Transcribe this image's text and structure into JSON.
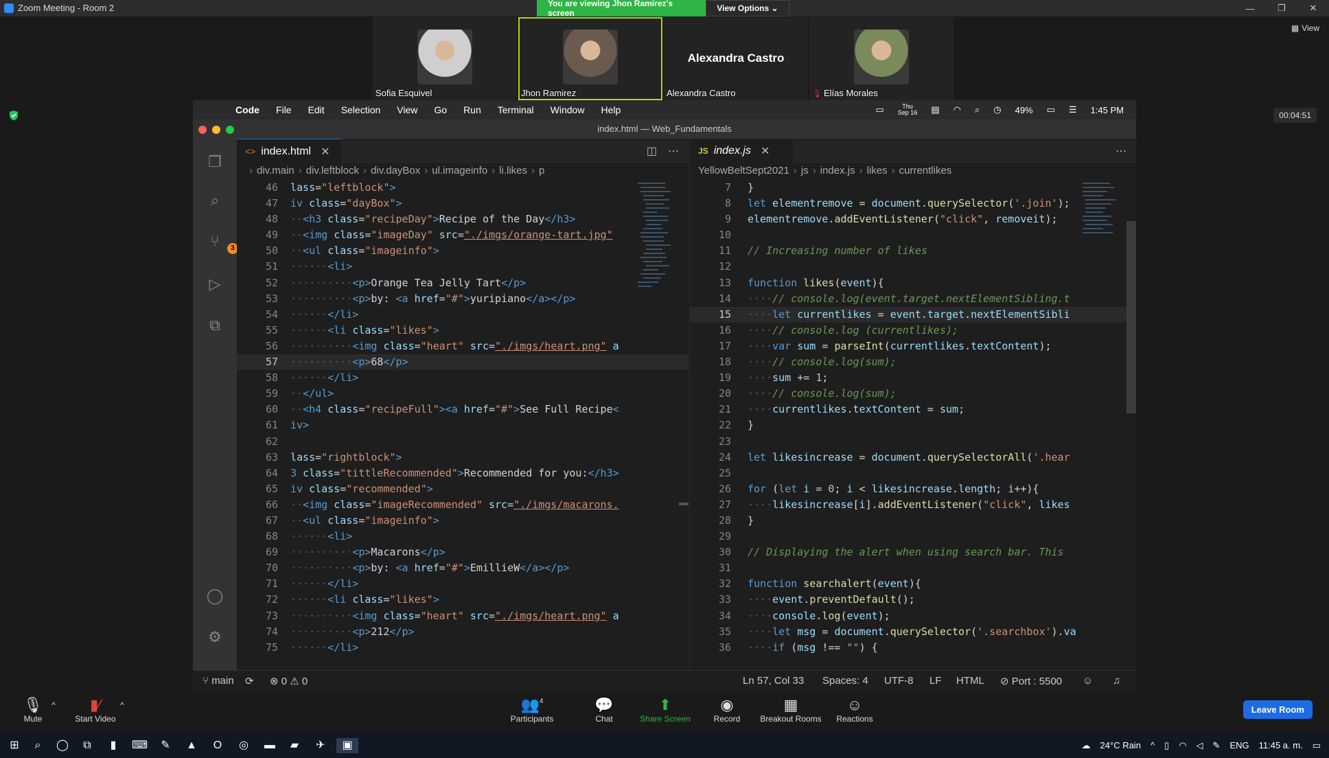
{
  "zoom": {
    "window_title": "Zoom Meeting - Room 2",
    "viewing_text": "You are viewing Jhon Ramirez's screen",
    "view_options": "View Options",
    "view_label": "View",
    "timer": "00:04:51",
    "participants": [
      {
        "name": "Sofia Esquivel",
        "photo_color": "#cfcfcf",
        "active": false,
        "muted": false
      },
      {
        "name": "Jhon Ramirez",
        "photo_color": "#6b5a4e",
        "active": true,
        "muted": false
      },
      {
        "name": "Alexandra Castro",
        "photo_color": null,
        "active": false,
        "muted": false,
        "big_name": "Alexandra Castro"
      },
      {
        "name": "Elías Morales",
        "photo_color": "#7a8a5a",
        "active": false,
        "muted": true
      }
    ],
    "toolbar": {
      "mute": "Mute",
      "start_video": "Start Video",
      "participants": "Participants",
      "participant_count": "4",
      "chat": "Chat",
      "share_screen": "Share Screen",
      "record": "Record",
      "breakout_rooms": "Breakout Rooms",
      "reactions": "Reactions",
      "leave_room": "Leave Room"
    }
  },
  "mac": {
    "menu": [
      "Code",
      "File",
      "Edit",
      "Selection",
      "View",
      "Go",
      "Run",
      "Terminal",
      "Window",
      "Help"
    ],
    "date_day": "Thu",
    "date": "Sep 16",
    "battery": "49%",
    "time": "1:45 PM"
  },
  "vscode": {
    "window_title": "index.html — Web_Fundamentals",
    "scm_badge": "3",
    "left_tab": "index.html",
    "right_tab": "index.js",
    "left_breadcrumb": [
      "div.main",
      "div.leftblock",
      "div.dayBox",
      "ul.imageinfo",
      "li.likes",
      "p"
    ],
    "right_breadcrumb": [
      "YellowBeltSept2021",
      "js",
      "index.js",
      "likes",
      "currentlikes"
    ],
    "status": {
      "branch": "main",
      "problems": "⊗ 0 ⚠ 0",
      "position": "Ln 57, Col 33",
      "spaces": "Spaces: 4",
      "encoding": "UTF-8",
      "eol": "LF",
      "language": "HTML",
      "port": "Port : 5500"
    },
    "left_lines": [
      {
        "n": "46",
        "h": "<span class='t-attr'>lass</span>=<span class='t-str'>\"leftblock\"</span><span class='t-tag'>&gt;</span>"
      },
      {
        "n": "47",
        "h": "<span class='t-tag'>iv</span> <span class='t-attr'>class</span>=<span class='t-str'>\"dayBox\"</span><span class='t-tag'>&gt;</span>"
      },
      {
        "n": "48",
        "h": "<span class='t-ws'>··</span><span class='t-tag'>&lt;h3</span> <span class='t-attr'>class</span>=<span class='t-str'>\"recipeDay\"</span><span class='t-tag'>&gt;</span>Recipe of the Day<span class='t-tag'>&lt;/h3&gt;</span>"
      },
      {
        "n": "49",
        "h": "<span class='t-ws'>··</span><span class='t-tag'>&lt;img</span> <span class='t-attr'>class</span>=<span class='t-str'>\"imageDay\"</span> <span class='t-attr'>src</span>=<span class='t-link'>\"./imgs/orange-tart.jpg\"</span>"
      },
      {
        "n": "50",
        "h": "<span class='t-ws'>··</span><span class='t-tag'>&lt;ul</span> <span class='t-attr'>class</span>=<span class='t-str'>\"imageinfo\"</span><span class='t-tag'>&gt;</span>"
      },
      {
        "n": "51",
        "h": "<span class='t-ws'>······</span><span class='t-tag'>&lt;li&gt;</span>"
      },
      {
        "n": "52",
        "h": "<span class='t-ws'>··········</span><span class='t-tag'>&lt;p&gt;</span>Orange Tea Jelly Tart<span class='t-tag'>&lt;/p&gt;</span>"
      },
      {
        "n": "53",
        "h": "<span class='t-ws'>··········</span><span class='t-tag'>&lt;p&gt;</span>by: <span class='t-tag'>&lt;a</span> <span class='t-attr'>href</span>=<span class='t-str'>\"#\"</span><span class='t-tag'>&gt;</span>yuripiano<span class='t-tag'>&lt;/a&gt;&lt;/p&gt;</span>"
      },
      {
        "n": "54",
        "h": "<span class='t-ws'>······</span><span class='t-tag'>&lt;/li&gt;</span>"
      },
      {
        "n": "55",
        "h": "<span class='t-ws'>······</span><span class='t-tag'>&lt;li</span> <span class='t-attr'>class</span>=<span class='t-str'>\"likes\"</span><span class='t-tag'>&gt;</span>"
      },
      {
        "n": "56",
        "h": "<span class='t-ws'>··········</span><span class='t-tag'>&lt;img</span> <span class='t-attr'>class</span>=<span class='t-str'>\"heart\"</span> <span class='t-attr'>src</span>=<span class='t-link'>\"./imgs/heart.png\"</span> <span class='t-attr'>a</span>"
      },
      {
        "n": "57",
        "h": "<span class='t-ws'>··········</span><span class='t-tag'>&lt;p&gt;</span>68<span class='t-tag'>&lt;/p&gt;</span>",
        "cur": true
      },
      {
        "n": "58",
        "h": "<span class='t-ws'>······</span><span class='t-tag'>&lt;/li&gt;</span>"
      },
      {
        "n": "59",
        "h": "<span class='t-ws'>··</span><span class='t-tag'>&lt;/ul&gt;</span>"
      },
      {
        "n": "60",
        "h": "<span class='t-ws'>··</span><span class='t-tag'>&lt;h4</span> <span class='t-attr'>class</span>=<span class='t-str'>\"recipeFull\"</span><span class='t-tag'>&gt;&lt;a</span> <span class='t-attr'>href</span>=<span class='t-str'>\"#\"</span><span class='t-tag'>&gt;</span>See Full Recipe<span class='t-tag'>&lt;</span>"
      },
      {
        "n": "61",
        "h": "<span class='t-tag'>iv&gt;</span>"
      },
      {
        "n": "62",
        "h": ""
      },
      {
        "n": "63",
        "h": "<span class='t-attr'>lass</span>=<span class='t-str'>\"rightblock\"</span><span class='t-tag'>&gt;</span>"
      },
      {
        "n": "64",
        "h": "<span class='t-tag'>3</span> <span class='t-attr'>class</span>=<span class='t-str'>\"tittleRecommended\"</span><span class='t-tag'>&gt;</span>Recommended for you:<span class='t-tag'>&lt;/h3&gt;</span>"
      },
      {
        "n": "65",
        "h": "<span class='t-tag'>iv</span> <span class='t-attr'>class</span>=<span class='t-str'>\"recommended\"</span><span class='t-tag'>&gt;</span>"
      },
      {
        "n": "66",
        "h": "<span class='t-ws'>··</span><span class='t-tag'>&lt;img</span> <span class='t-attr'>class</span>=<span class='t-str'>\"imageRecommended\"</span> <span class='t-attr'>src</span>=<span class='t-link'>\"./imgs/macarons.</span>"
      },
      {
        "n": "67",
        "h": "<span class='t-ws'>··</span><span class='t-tag'>&lt;ul</span> <span class='t-attr'>class</span>=<span class='t-str'>\"imageinfo\"</span><span class='t-tag'>&gt;</span>"
      },
      {
        "n": "68",
        "h": "<span class='t-ws'>······</span><span class='t-tag'>&lt;li&gt;</span>"
      },
      {
        "n": "69",
        "h": "<span class='t-ws'>··········</span><span class='t-tag'>&lt;p&gt;</span>Macarons<span class='t-tag'>&lt;/p&gt;</span>"
      },
      {
        "n": "70",
        "h": "<span class='t-ws'>··········</span><span class='t-tag'>&lt;p&gt;</span>by: <span class='t-tag'>&lt;a</span> <span class='t-attr'>href</span>=<span class='t-str'>\"#\"</span><span class='t-tag'>&gt;</span>EmillieW<span class='t-tag'>&lt;/a&gt;&lt;/p&gt;</span>"
      },
      {
        "n": "71",
        "h": "<span class='t-ws'>······</span><span class='t-tag'>&lt;/li&gt;</span>"
      },
      {
        "n": "72",
        "h": "<span class='t-ws'>······</span><span class='t-tag'>&lt;li</span> <span class='t-attr'>class</span>=<span class='t-str'>\"likes\"</span><span class='t-tag'>&gt;</span>"
      },
      {
        "n": "73",
        "h": "<span class='t-ws'>··········</span><span class='t-tag'>&lt;img</span> <span class='t-attr'>class</span>=<span class='t-str'>\"heart\"</span> <span class='t-attr'>src</span>=<span class='t-link'>\"./imgs/heart.png\"</span> <span class='t-attr'>a</span>"
      },
      {
        "n": "74",
        "h": "<span class='t-ws'>··········</span><span class='t-tag'>&lt;p&gt;</span>212<span class='t-tag'>&lt;/p&gt;</span>"
      },
      {
        "n": "75",
        "h": "<span class='t-ws'>······</span><span class='t-tag'>&lt;/li&gt;</span>"
      }
    ],
    "right_lines": [
      {
        "n": "7",
        "h": "}"
      },
      {
        "n": "8",
        "h": "<span class='t-kw'>let</span> <span class='t-var'>elementremove</span> = <span class='t-var'>document</span>.<span class='t-fn'>querySelector</span>(<span class='t-str'>'.join'</span>);"
      },
      {
        "n": "9",
        "h": "<span class='t-var'>elementremove</span>.<span class='t-fn'>addEventListener</span>(<span class='t-str'>\"click\"</span>, <span class='t-var'>removeit</span>);"
      },
      {
        "n": "10",
        "h": ""
      },
      {
        "n": "11",
        "h": "<span class='t-cmt'>// Increasing number of likes</span>"
      },
      {
        "n": "12",
        "h": ""
      },
      {
        "n": "13",
        "h": "<span class='t-kw'>function</span> <span class='t-fn'>likes</span>(<span class='t-var'>event</span>){"
      },
      {
        "n": "14",
        "h": "<span class='t-ws'>····</span><span class='t-cmt'>// console.log(event.target.nextElementSibling.t</span>"
      },
      {
        "n": "15",
        "h": "<span class='t-ws'>····</span><span class='t-kw'>let</span> <span class='t-var'>currentlikes</span> = <span class='t-var'>event</span>.<span class='t-var'>target</span>.<span class='t-var'>nextElementSibli</span>",
        "cur": true
      },
      {
        "n": "16",
        "h": "<span class='t-ws'>····</span><span class='t-cmt'>// console.log (currentlikes);</span>"
      },
      {
        "n": "17",
        "h": "<span class='t-ws'>····</span><span class='t-kw'>var</span> <span class='t-var'>sum</span> = <span class='t-fn'>parseInt</span>(<span class='t-var'>currentlikes</span>.<span class='t-var'>textContent</span>);"
      },
      {
        "n": "18",
        "h": "<span class='t-ws'>····</span><span class='t-cmt'>// console.log(sum);</span>"
      },
      {
        "n": "19",
        "h": "<span class='t-ws'>····</span><span class='t-var'>sum</span> += <span class='t-num'>1</span>;"
      },
      {
        "n": "20",
        "h": "<span class='t-ws'>····</span><span class='t-cmt'>// console.log(sum);</span>"
      },
      {
        "n": "21",
        "h": "<span class='t-ws'>····</span><span class='t-var'>currentlikes</span>.<span class='t-var'>textContent</span> = <span class='t-var'>sum</span>;"
      },
      {
        "n": "22",
        "h": "}"
      },
      {
        "n": "23",
        "h": ""
      },
      {
        "n": "24",
        "h": "<span class='t-kw'>let</span> <span class='t-var'>likesincrease</span> = <span class='t-var'>document</span>.<span class='t-fn'>querySelectorAll</span>(<span class='t-str'>'.hear</span>"
      },
      {
        "n": "25",
        "h": ""
      },
      {
        "n": "26",
        "h": "<span class='t-kw'>for</span> (<span class='t-kw'>let</span> <span class='t-var'>i</span> = <span class='t-num'>0</span>; <span class='t-var'>i</span> &lt; <span class='t-var'>likesincrease</span>.<span class='t-var'>length</span>; <span class='t-var'>i</span>++){"
      },
      {
        "n": "27",
        "h": "<span class='t-ws'>····</span><span class='t-var'>likesincrease</span>[<span class='t-var'>i</span>].<span class='t-fn'>addEventListener</span>(<span class='t-str'>\"click\"</span>, <span class='t-var'>likes</span>"
      },
      {
        "n": "28",
        "h": "}"
      },
      {
        "n": "29",
        "h": ""
      },
      {
        "n": "30",
        "h": "<span class='t-cmt'>// Displaying the alert when using search bar. This</span>"
      },
      {
        "n": "31",
        "h": ""
      },
      {
        "n": "32",
        "h": "<span class='t-kw'>function</span> <span class='t-fn'>searchalert</span>(<span class='t-var'>event</span>){"
      },
      {
        "n": "33",
        "h": "<span class='t-ws'>····</span><span class='t-var'>event</span>.<span class='t-fn'>preventDefault</span>();"
      },
      {
        "n": "34",
        "h": "<span class='t-ws'>····</span><span class='t-var'>console</span>.<span class='t-fn'>log</span>(<span class='t-var'>event</span>);"
      },
      {
        "n": "35",
        "h": "<span class='t-ws'>····</span><span class='t-kw'>let</span> <span class='t-var'>msg</span> = <span class='t-var'>document</span>.<span class='t-fn'>querySelector</span>(<span class='t-str'>'.searchbox'</span>).<span class='t-var'>va</span>"
      },
      {
        "n": "36",
        "h": "<span class='t-ws'>····</span><span class='t-kw'>if</span> (<span class='t-var'>msg</span> !== <span class='t-str'>\"\"</span>) {"
      }
    ]
  },
  "taskbar": {
    "weather": "24°C  Rain",
    "lang": "ENG",
    "time": "11:45 a. m."
  }
}
